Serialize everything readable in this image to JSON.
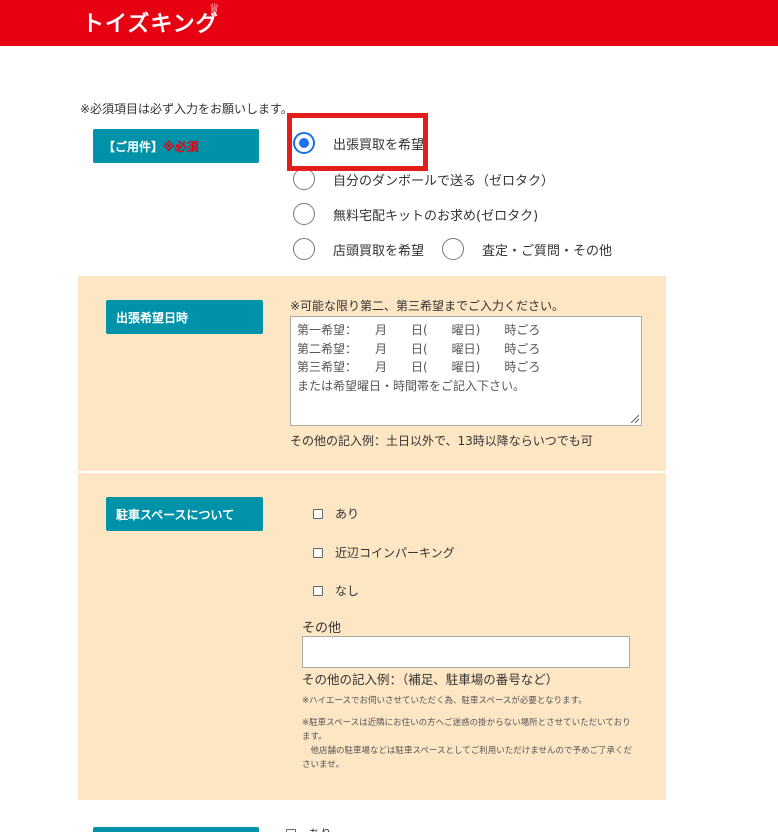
{
  "header": {
    "logo": "トイズキング",
    "crown": "♕",
    "bg_color": "#e60012"
  },
  "form": {
    "required_note": "※必須項目は必ず入力をお願いします。",
    "service": {
      "label": "【ご用件】",
      "required": "※必須",
      "options": [
        {
          "label": "出張買取を希望",
          "checked": true
        },
        {
          "label": "自分のダンボールで送る（ゼロタク）",
          "checked": false
        },
        {
          "label": "無料宅配キットのお求め(ゼロタク)",
          "checked": false
        },
        {
          "label": "店頭買取を希望",
          "checked": false
        },
        {
          "label": "査定・ご質問・その他",
          "checked": false
        }
      ]
    },
    "visit_date": {
      "label": "出張希望日時",
      "hint": "※可能な限り第二、第三希望までご入力ください。",
      "textarea_lines": [
        "第一希望：　　月　　日(　　曜日)　　時ごろ",
        "第二希望：　　月　　日(　　曜日)　　時ごろ",
        "第三希望：　　月　　日(　　曜日)　　時ごろ",
        "または希望曜日・時間帯をご記入下さい。"
      ],
      "example": "その他の記入例：土日以外で、13時以降ならいつでも可"
    },
    "parking": {
      "label": "駐車スペースについて",
      "options": [
        {
          "label": "あり",
          "checked": false
        },
        {
          "label": "近辺コインパーキング",
          "checked": false
        },
        {
          "label": "なし",
          "checked": false
        }
      ],
      "other_label": "その他",
      "other_value": "",
      "other_example": "その他の記入例：（補足、駐車場の番号など）",
      "note1": "※ハイエースでお伺いさせていただく為、駐車スペースが必要となります。",
      "note2_line1": "※駐車スペースは近隣にお住いの方へご迷惑の掛からない場所とさせていただいており",
      "note2_line2": "ます。",
      "note2_line3": "　他店舗の駐車場などは駐車スペースとしてご利用いただけませんので予めご了承くだ",
      "note2_line4": "さいませ。"
    },
    "next_section": {
      "first_option": "あり"
    }
  },
  "colors": {
    "accent": "#0092a8",
    "panel_bg": "#fde6c4",
    "highlight": "#e31c1c",
    "radio_selected": "#1a73e8"
  }
}
